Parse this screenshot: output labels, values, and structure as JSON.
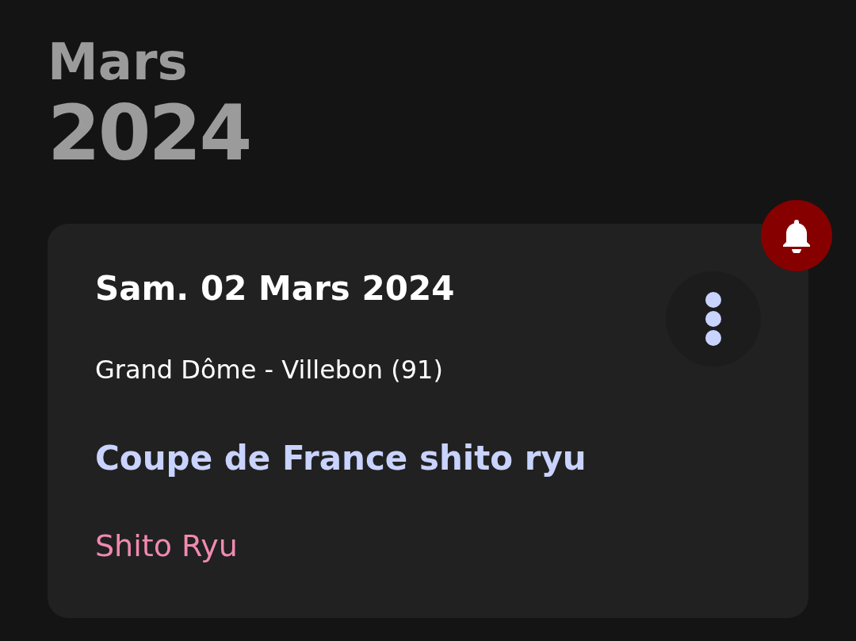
{
  "header": {
    "month": "Mars",
    "year": "2024"
  },
  "event": {
    "date": "Sam. 02 Mars 2024",
    "location": "Grand Dôme - Villebon (91)",
    "title": "Coupe de France shito ryu",
    "category": "Shito Ryu",
    "notified": true
  }
}
